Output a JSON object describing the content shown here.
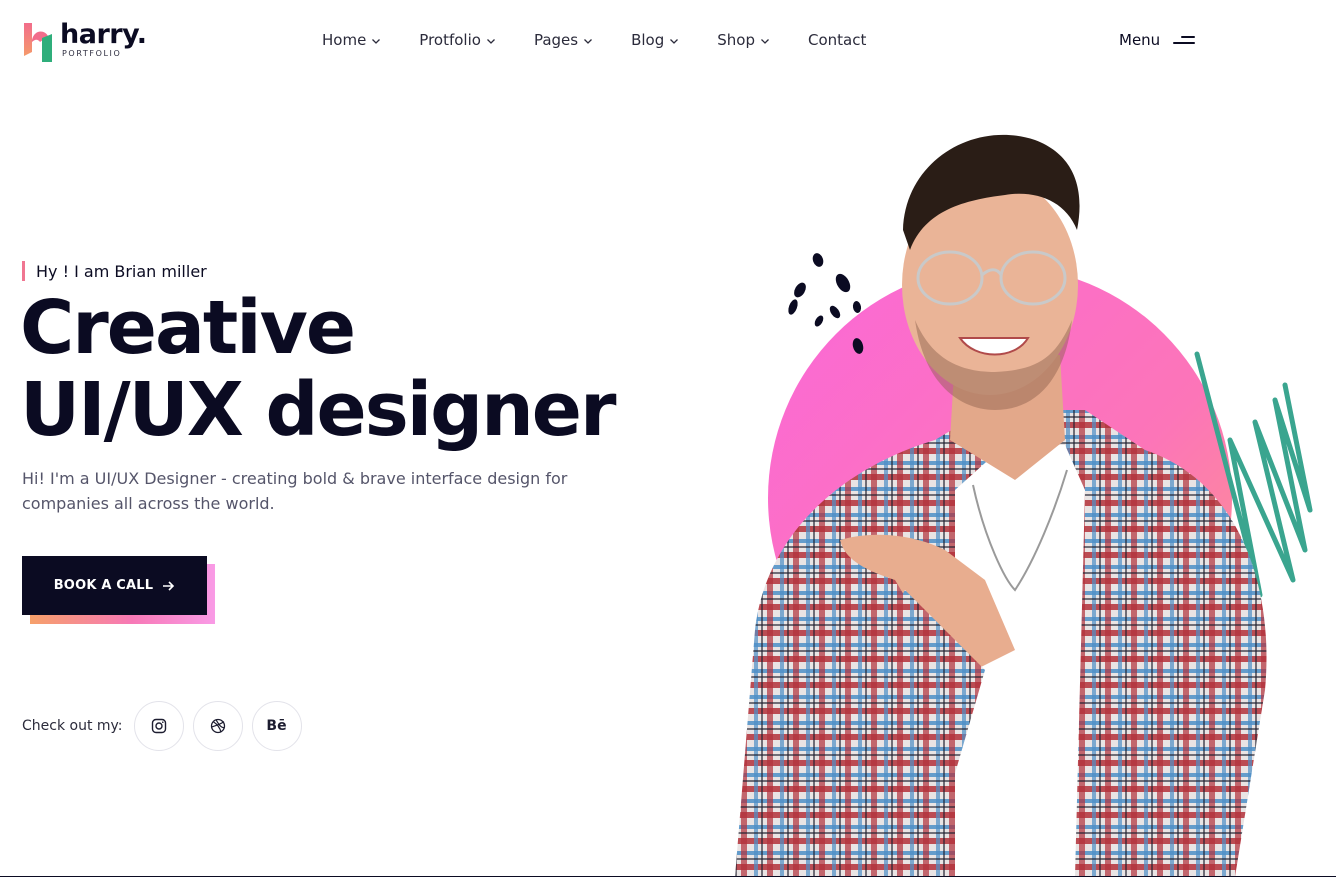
{
  "brand": {
    "name": "harry.",
    "subtitle": "PORTFOLIO"
  },
  "nav": {
    "items": [
      {
        "label": "Home",
        "has_dropdown": true
      },
      {
        "label": "Protfolio",
        "has_dropdown": true
      },
      {
        "label": "Pages",
        "has_dropdown": true
      },
      {
        "label": "Blog",
        "has_dropdown": true
      },
      {
        "label": "Shop",
        "has_dropdown": true
      },
      {
        "label": "Contact",
        "has_dropdown": false
      }
    ],
    "menu_label": "Menu",
    "menu_icon": "hamburger-icon"
  },
  "hero": {
    "tagline": "Hy ! I am Brian miller",
    "title_line1": "Creative",
    "title_line2": "UI/UX designer",
    "description": "Hi! I'm a UI/UX Designer - creating bold & brave interface design for companies all across the world.",
    "cta_label": "BOOK A CALL",
    "cta_icon": "arrow-right-icon",
    "social_label": "Check out my:",
    "social": [
      {
        "name": "instagram",
        "icon": "instagram-icon"
      },
      {
        "name": "dribbble",
        "icon": "dribbble-icon"
      },
      {
        "name": "behance",
        "icon": "behance-icon",
        "glyph": "Bē"
      }
    ]
  },
  "colors": {
    "dark": "#0b0b22",
    "accent_pink": "#f779b6",
    "accent_orange": "#f6a06a",
    "accent_teal": "#3aa58f",
    "tagline_bar": "#f07691"
  }
}
